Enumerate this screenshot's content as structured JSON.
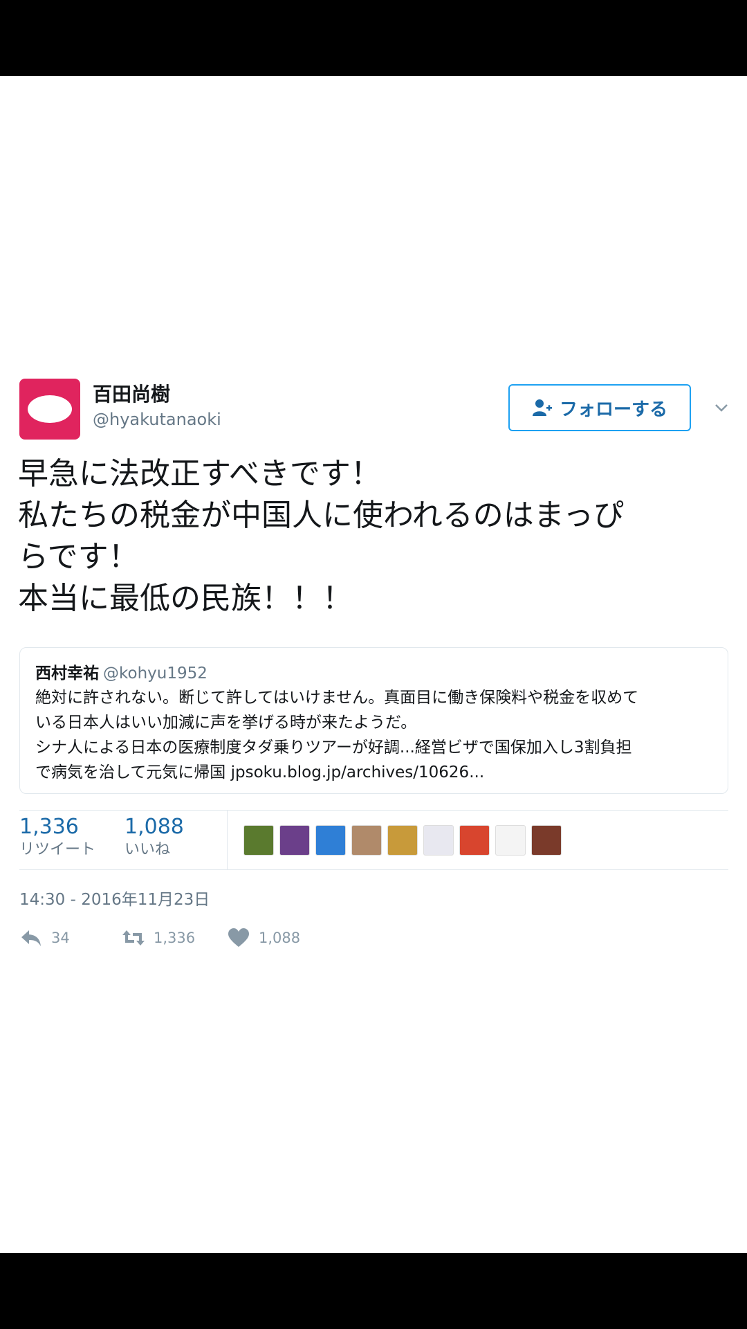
{
  "tweet": {
    "display_name": "百田尚樹",
    "handle": "@hyakutanaoki",
    "follow_label": "フォローする",
    "text_lines": [
      "早急に法改正すべきです！",
      "私たちの税金が中国人に使われるのはまっぴ",
      "らです！",
      "本当に最低の民族！！！"
    ],
    "timestamp": "14:30 - 2016年11月23日"
  },
  "quoted": {
    "name": "西村幸祐",
    "handle": "@kohyu1952",
    "lines": [
      "絶対に許されない。断じて許してはいけません。真面目に働き保険料や税金を収めて",
      "いる日本人はいい加減に声を挙げる時が来たようだ。",
      "シナ人による日本の医療制度タダ乗りツアーが好調...経営ビザで国保加入し3割負担",
      "で病気を治して元気に帰国 jpsoku.blog.jp/archives/10626..."
    ]
  },
  "stats": {
    "retweets": "1,336",
    "retweets_label": "リツイート",
    "likes": "1,088",
    "likes_label": "いいね"
  },
  "actions": {
    "reply_count": "34",
    "retweet_count": "1,336",
    "like_count": "1,088"
  },
  "colors": {
    "avatar": "#e0245e",
    "accent": "#1da1f2",
    "link_text": "#1b6aa8",
    "muted": "#657786"
  },
  "liker_colors": [
    "#5a7a2e",
    "#6b3f8a",
    "#2f7fd6",
    "#b08a6a",
    "#c89a3a",
    "#e8e8f0",
    "#d8452e",
    "#f4f4f4",
    "#7a3a2a"
  ]
}
